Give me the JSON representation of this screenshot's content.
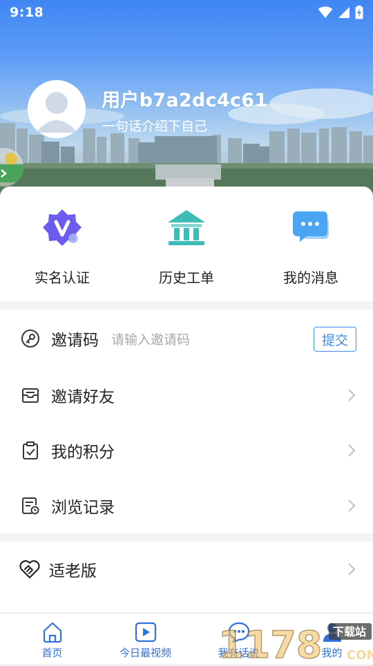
{
  "status_bar": {
    "time": "9:18"
  },
  "profile": {
    "username": "用户b7a2dc4c61",
    "bio_placeholder": "一句话介绍下自己"
  },
  "quick_actions": [
    {
      "label": "实名认证",
      "icon": "verified-v-badge-icon"
    },
    {
      "label": "历史工单",
      "icon": "building-columns-icon"
    },
    {
      "label": "我的消息",
      "icon": "chat-bubble-icon"
    }
  ],
  "invite_code": {
    "label": "邀请码",
    "placeholder": "请输入邀请码",
    "submit_label": "提交"
  },
  "menu": [
    {
      "label": "邀请好友",
      "icon": "inbox-icon"
    },
    {
      "label": "我的积分",
      "icon": "clipboard-check-icon"
    },
    {
      "label": "浏览记录",
      "icon": "history-document-icon"
    }
  ],
  "elder_mode": {
    "label": "适老版",
    "icon": "handshake-heart-icon"
  },
  "bottom_nav": [
    {
      "label": "首页",
      "icon": "home-icon"
    },
    {
      "label": "今日最视频",
      "icon": "play-icon"
    },
    {
      "label": "我有话说",
      "icon": "speech-bubble-icon"
    },
    {
      "label": "我的",
      "icon": "person-icon"
    }
  ],
  "watermark": {
    "text": "下载站",
    "digits": "1178",
    "suffix": "COM"
  },
  "colors": {
    "accent": "#3a8ee6",
    "nav_label": "#2f6fde",
    "header_sky": "#3f86f4",
    "badge_purple": "#6b5cf0",
    "teal_icon": "#3dbdb6",
    "message_blue": "#4aa6f2"
  }
}
